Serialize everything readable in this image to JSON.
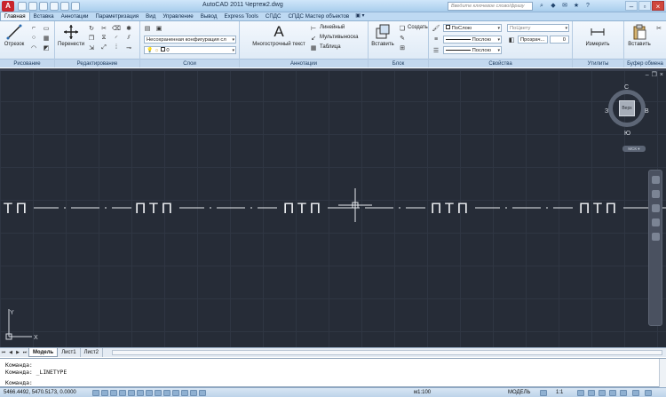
{
  "app": {
    "title": "AutoCAD 2011   Чертеж2.dwg",
    "search_placeholder": "Введите ключевое слово/фразу",
    "accent": "#c8242b"
  },
  "ribbon_tabs": [
    {
      "label": "Главная",
      "active": true
    },
    {
      "label": "Вставка"
    },
    {
      "label": "Аннотации"
    },
    {
      "label": "Параметризация"
    },
    {
      "label": "Вид"
    },
    {
      "label": "Управление"
    },
    {
      "label": "Вывод"
    },
    {
      "label": "Express Tools"
    },
    {
      "label": "СПДС"
    },
    {
      "label": "СПДС Мастер объектов"
    }
  ],
  "panels": {
    "draw": {
      "label": "Рисование",
      "line": "Отрезок"
    },
    "modify": {
      "label": "Редактирование",
      "move": "Перенести"
    },
    "layers": {
      "label": "Слои",
      "state": "Несохраненная конфигурация сл",
      "current_layer": "0"
    },
    "annotation": {
      "label": "Аннотации",
      "mtext": "Многострочный текст",
      "linear": "Линейный",
      "multileader": "Мультивыноска",
      "table": "Таблица"
    },
    "block": {
      "label": "Блок",
      "insert": "Вставить",
      "create": "Создать"
    },
    "properties": {
      "label": "Свойства",
      "color": "ПоСлою",
      "linetype": "Послою",
      "lineweight": "Послою",
      "plotstyle": "ПоЦвету",
      "transparency": "Прозрач...",
      "transparency_value": "0"
    },
    "utilities": {
      "label": "Утилиты",
      "measure": "Измерить"
    },
    "clipboard": {
      "label": "Буфер обмена",
      "paste": "Вставить"
    }
  },
  "drawing": {
    "linetype_text": "ПТП",
    "viewcube": {
      "north": "С",
      "south": "Ю",
      "west": "З",
      "east": "В",
      "face": "Верх",
      "wcs": "МСК"
    },
    "bg_color": "#262c37"
  },
  "layout_tabs": [
    {
      "label": "Модель",
      "active": true
    },
    {
      "label": "Лист1"
    },
    {
      "label": "Лист2"
    }
  ],
  "command_line": {
    "lines": [
      "Команда:",
      "Команда: _LINETYPE"
    ],
    "prompt": "Команда:"
  },
  "status": {
    "coordinates": "5466.4492, 5470.5173, 0.0000",
    "scale": "м1:100",
    "space": "МОДЕЛЬ",
    "annotation_scale": "1:1"
  }
}
